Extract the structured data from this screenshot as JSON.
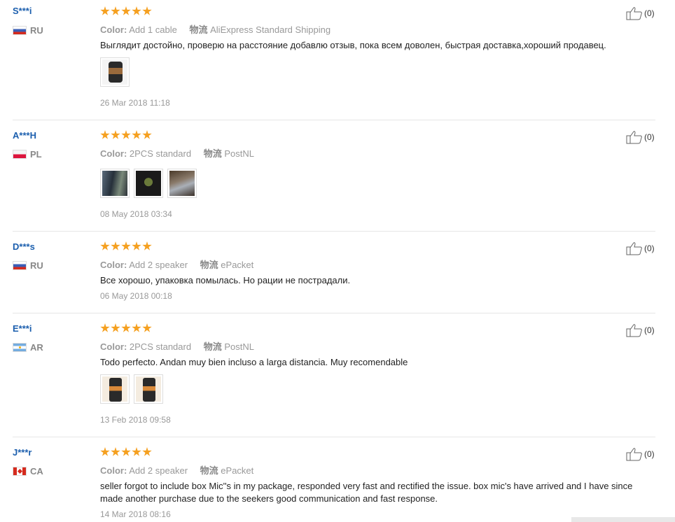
{
  "reviews": [
    {
      "user": "S***i",
      "country": "RU",
      "flag": "ru",
      "rating": 5,
      "color_label": "Color:",
      "color_value": "Add 1 cable",
      "shipping_label": "物流",
      "shipping_value": "AliExpress Standard Shipping",
      "text": "Выглядит достойно, проверю на расстояние добавлю отзыв, пока всем доволен, быстрая доставка,хороший продавец.",
      "date": "26 Mar 2018 11:18",
      "helpful_count": "(0)"
    },
    {
      "user": "A***H",
      "country": "PL",
      "flag": "pl",
      "rating": 5,
      "color_label": "Color:",
      "color_value": "2PCS standard",
      "shipping_label": "物流",
      "shipping_value": "PostNL",
      "text": "",
      "date": "08 May 2018 03:34",
      "helpful_count": "(0)"
    },
    {
      "user": "D***s",
      "country": "RU",
      "flag": "ru",
      "rating": 5,
      "color_label": "Color:",
      "color_value": "Add 2 speaker",
      "shipping_label": "物流",
      "shipping_value": "ePacket",
      "text": "Все хорошо, упаковка помылась. Но рации не пострадали.",
      "date": "06 May 2018 00:18",
      "helpful_count": "(0)"
    },
    {
      "user": "E***i",
      "country": "AR",
      "flag": "ar",
      "rating": 5,
      "color_label": "Color:",
      "color_value": "2PCS standard",
      "shipping_label": "物流",
      "shipping_value": "PostNL",
      "text": "Todo perfecto. Andan muy bien incluso a larga distancia. Muy recomendable",
      "date": "13 Feb 2018 09:58",
      "helpful_count": "(0)"
    },
    {
      "user": "J***r",
      "country": "CA",
      "flag": "ca",
      "rating": 5,
      "color_label": "Color:",
      "color_value": "Add 2 speaker",
      "shipping_label": "物流",
      "shipping_value": "ePacket",
      "text": "seller forgot to include box Mic''s in my package, responded very fast and rectified the issue. box mic's have arrived and I have since made another purchase due to the seekers good communication and fast response.",
      "date": "14 Mar 2018 08:16",
      "helpful_count": "(0)"
    }
  ],
  "colors": {
    "star": "#f5a020",
    "username": "#1c5fae",
    "muted": "#999999"
  }
}
